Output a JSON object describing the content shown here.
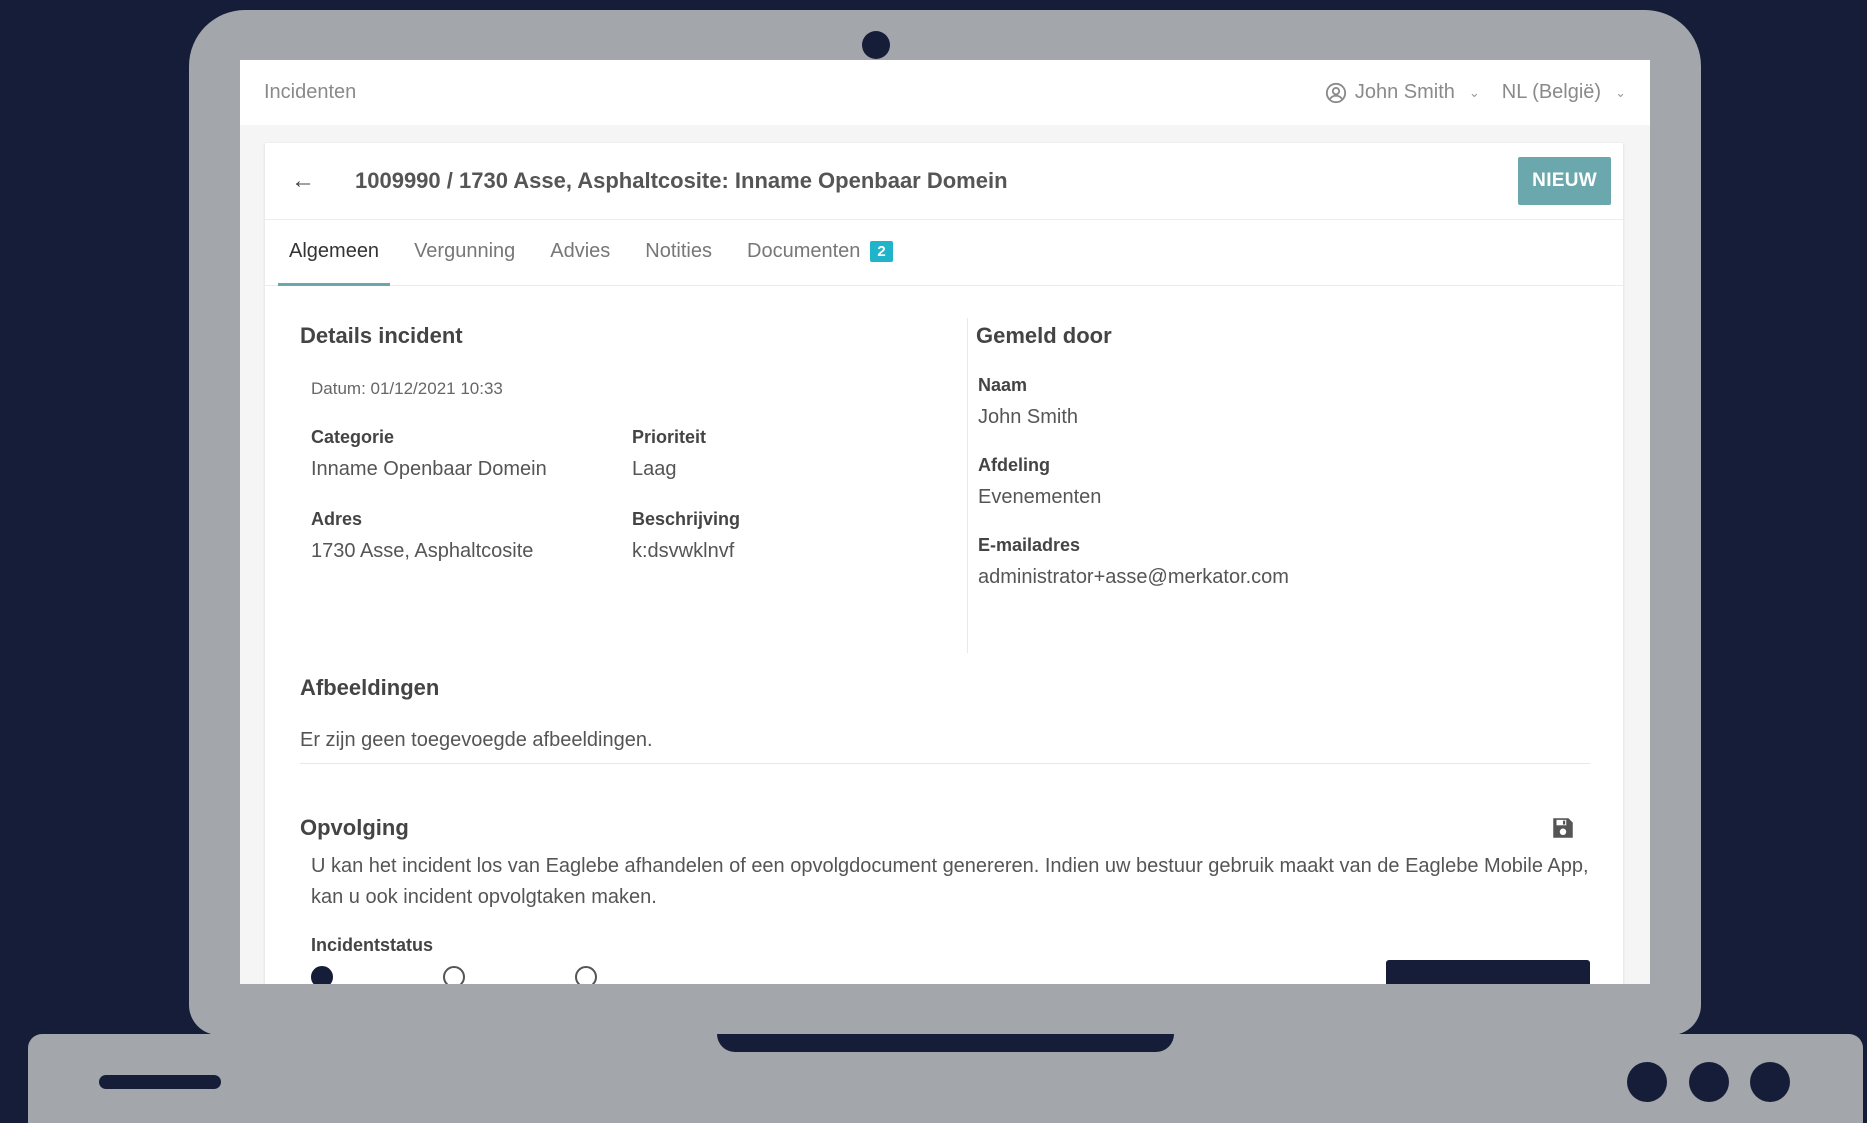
{
  "topbar": {
    "breadcrumb": "Incidenten",
    "user_name": "John Smith",
    "language": "NL (België)"
  },
  "header": {
    "title": "1009990 / 1730 Asse, Asphaltcosite: Inname Openbaar Domein",
    "status": "NIEUW"
  },
  "tabs": [
    {
      "label": "Algemeen",
      "active": true
    },
    {
      "label": "Vergunning"
    },
    {
      "label": "Advies"
    },
    {
      "label": "Notities"
    },
    {
      "label": "Documenten",
      "badge": "2"
    }
  ],
  "details": {
    "title": "Details incident",
    "date": "Datum: 01/12/2021 10:33",
    "fields": [
      {
        "label": "Categorie",
        "value": "Inname Openbaar Domein"
      },
      {
        "label": "Prioriteit",
        "value": "Laag"
      },
      {
        "label": "Adres",
        "value": "1730 Asse, Asphaltcosite"
      },
      {
        "label": "Beschrijving",
        "value": "k:dsvwklnvf"
      }
    ]
  },
  "reporter": {
    "title": "Gemeld door",
    "fields": [
      {
        "label": "Naam",
        "value": "John Smith"
      },
      {
        "label": "Afdeling",
        "value": "Evenementen"
      },
      {
        "label": "E-mailadres",
        "value": "administrator+asse@merkator.com"
      }
    ]
  },
  "images": {
    "title": "Afbeeldingen",
    "empty_text": "Er zijn geen toegevoegde afbeeldingen."
  },
  "followup": {
    "title": "Opvolging",
    "description": "U kan het incident los van Eaglebe afhandelen of een opvolgdocument genereren. Indien uw bestuur gebruik maakt van de Eaglebe Mobile App, kan u ook incident opvolgtaken maken.",
    "status_label": "Incidentstatus"
  },
  "colors": {
    "background": "#161d38",
    "accent": "#6aa8ad",
    "badge": "#1fb4c9"
  }
}
